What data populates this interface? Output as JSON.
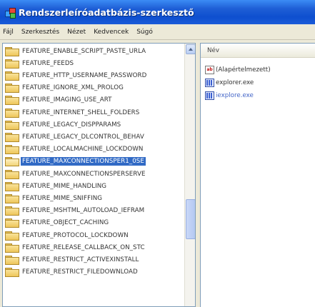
{
  "window": {
    "title": "Rendszerleíróadatbázis-szerkesztő"
  },
  "menu": [
    {
      "label": "Fájl"
    },
    {
      "label": "Szerkesztés"
    },
    {
      "label": "Nézet"
    },
    {
      "label": "Kedvencek"
    },
    {
      "label": "Súgó"
    }
  ],
  "tree": {
    "items": [
      {
        "label": "FEATURE_ENABLE_SCRIPT_PASTE_URLA",
        "selected": false
      },
      {
        "label": "FEATURE_FEEDS",
        "selected": false
      },
      {
        "label": "FEATURE_HTTP_USERNAME_PASSWORD",
        "selected": false
      },
      {
        "label": "FEATURE_IGNORE_XML_PROLOG",
        "selected": false
      },
      {
        "label": "FEATURE_IMAGING_USE_ART",
        "selected": false
      },
      {
        "label": "FEATURE_INTERNET_SHELL_FOLDERS",
        "selected": false
      },
      {
        "label": "FEATURE_LEGACY_DISPPARAMS",
        "selected": false
      },
      {
        "label": "FEATURE_LEGACY_DLCONTROL_BEHAV",
        "selected": false
      },
      {
        "label": "FEATURE_LOCALMACHINE_LOCKDOWN",
        "selected": false
      },
      {
        "label": "FEATURE_MAXCONNECTIONSPER1_0SE",
        "selected": true
      },
      {
        "label": "FEATURE_MAXCONNECTIONSPERSERVE",
        "selected": false
      },
      {
        "label": "FEATURE_MIME_HANDLING",
        "selected": false
      },
      {
        "label": "FEATURE_MIME_SNIFFING",
        "selected": false
      },
      {
        "label": "FEATURE_MSHTML_AUTOLOAD_IEFRAM",
        "selected": false
      },
      {
        "label": "FEATURE_OBJECT_CACHING",
        "selected": false
      },
      {
        "label": "FEATURE_PROTOCOL_LOCKDOWN",
        "selected": false
      },
      {
        "label": "FEATURE_RELEASE_CALLBACK_ON_STC",
        "selected": false
      },
      {
        "label": "FEATURE_RESTRICT_ACTIVEXINSTALL",
        "selected": false
      },
      {
        "label": "FEATURE_RESTRICT_FILEDOWNLOAD",
        "selected": false
      }
    ]
  },
  "list": {
    "column_name": "Név",
    "values": [
      {
        "name": "(Alapértelmezett)",
        "icon": "string-value-icon"
      },
      {
        "name": "explorer.exe",
        "icon": "dword-value-icon"
      },
      {
        "name": "iexplore.exe",
        "icon": "dword-value-icon"
      }
    ]
  },
  "colors": {
    "titlebar": "#0e4fcf",
    "selection": "#316ac5",
    "folder": "#eec65a"
  }
}
